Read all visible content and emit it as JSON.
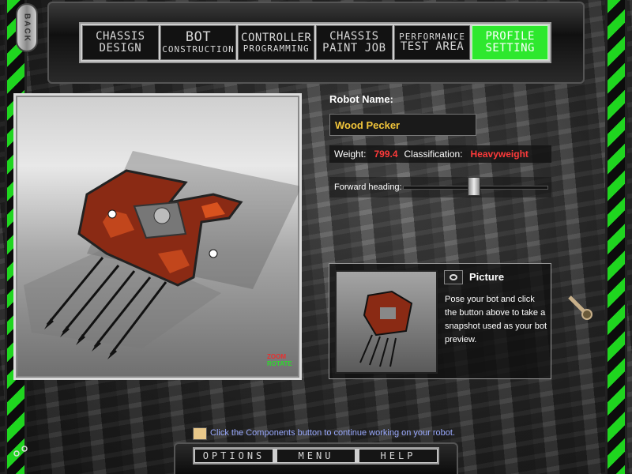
{
  "back_button": {
    "label": "BACK"
  },
  "tabs": [
    {
      "line1": "CHASSIS",
      "line2": "DESIGN",
      "active": false
    },
    {
      "line1": "BOT",
      "line2": "CONSTRUCTION",
      "active": false
    },
    {
      "line1": "CONTROLLER",
      "line2": "PROGRAMMING",
      "active": false
    },
    {
      "line1": "CHASSIS",
      "line2": "PAINT JOB",
      "active": false
    },
    {
      "line1": "PERFORMANCE",
      "line2": "TEST AREA",
      "active": false
    },
    {
      "line1": "PROFILE",
      "line2": "SETTING",
      "active": true
    }
  ],
  "viewport": {
    "zoom_label": "ZOOM",
    "rotate_label": "ROTATE"
  },
  "profile": {
    "robot_name_label": "Robot Name:",
    "robot_name_value": "Wood Pecker",
    "weight_label": "Weight:",
    "weight_value": "799.4",
    "classification_label": "Classification:",
    "classification_value": "Heavyweight",
    "forward_heading_label": "Forward heading:",
    "forward_heading_level": 0.49
  },
  "picture": {
    "title": "Picture",
    "description": "Pose your bot and click the button above to take a snapshot used as your bot preview."
  },
  "tip": {
    "text": "Click the Components button to continue working on your robot."
  },
  "bottom_buttons": {
    "options": "OPTIONS",
    "menu": "MENU",
    "help": "HELP"
  },
  "colors": {
    "accent_green": "#2ee82e",
    "value_red": "#ff3a3a",
    "name_yellow": "#f2c53a",
    "tip_blue": "#9aaaff"
  }
}
